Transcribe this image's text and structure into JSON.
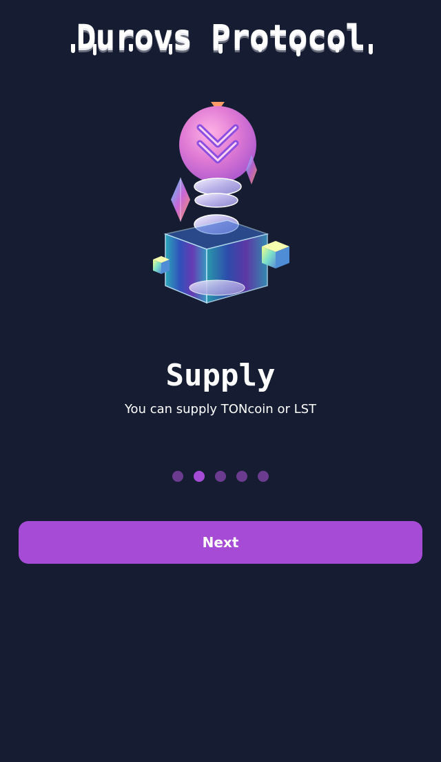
{
  "header": {
    "app_title": "Durovs Protocol"
  },
  "slide": {
    "illustration": "supply-box-coins-illustration",
    "title": "Supply",
    "subtitle": "You can supply TONcoin or LST"
  },
  "pagination": {
    "total": 5,
    "current": 2
  },
  "footer": {
    "next_label": "Next"
  },
  "colors": {
    "background": "#161d33",
    "accent": "#a64bd6",
    "dot_inactive": "#6b3b8f",
    "text": "#ffffff"
  }
}
